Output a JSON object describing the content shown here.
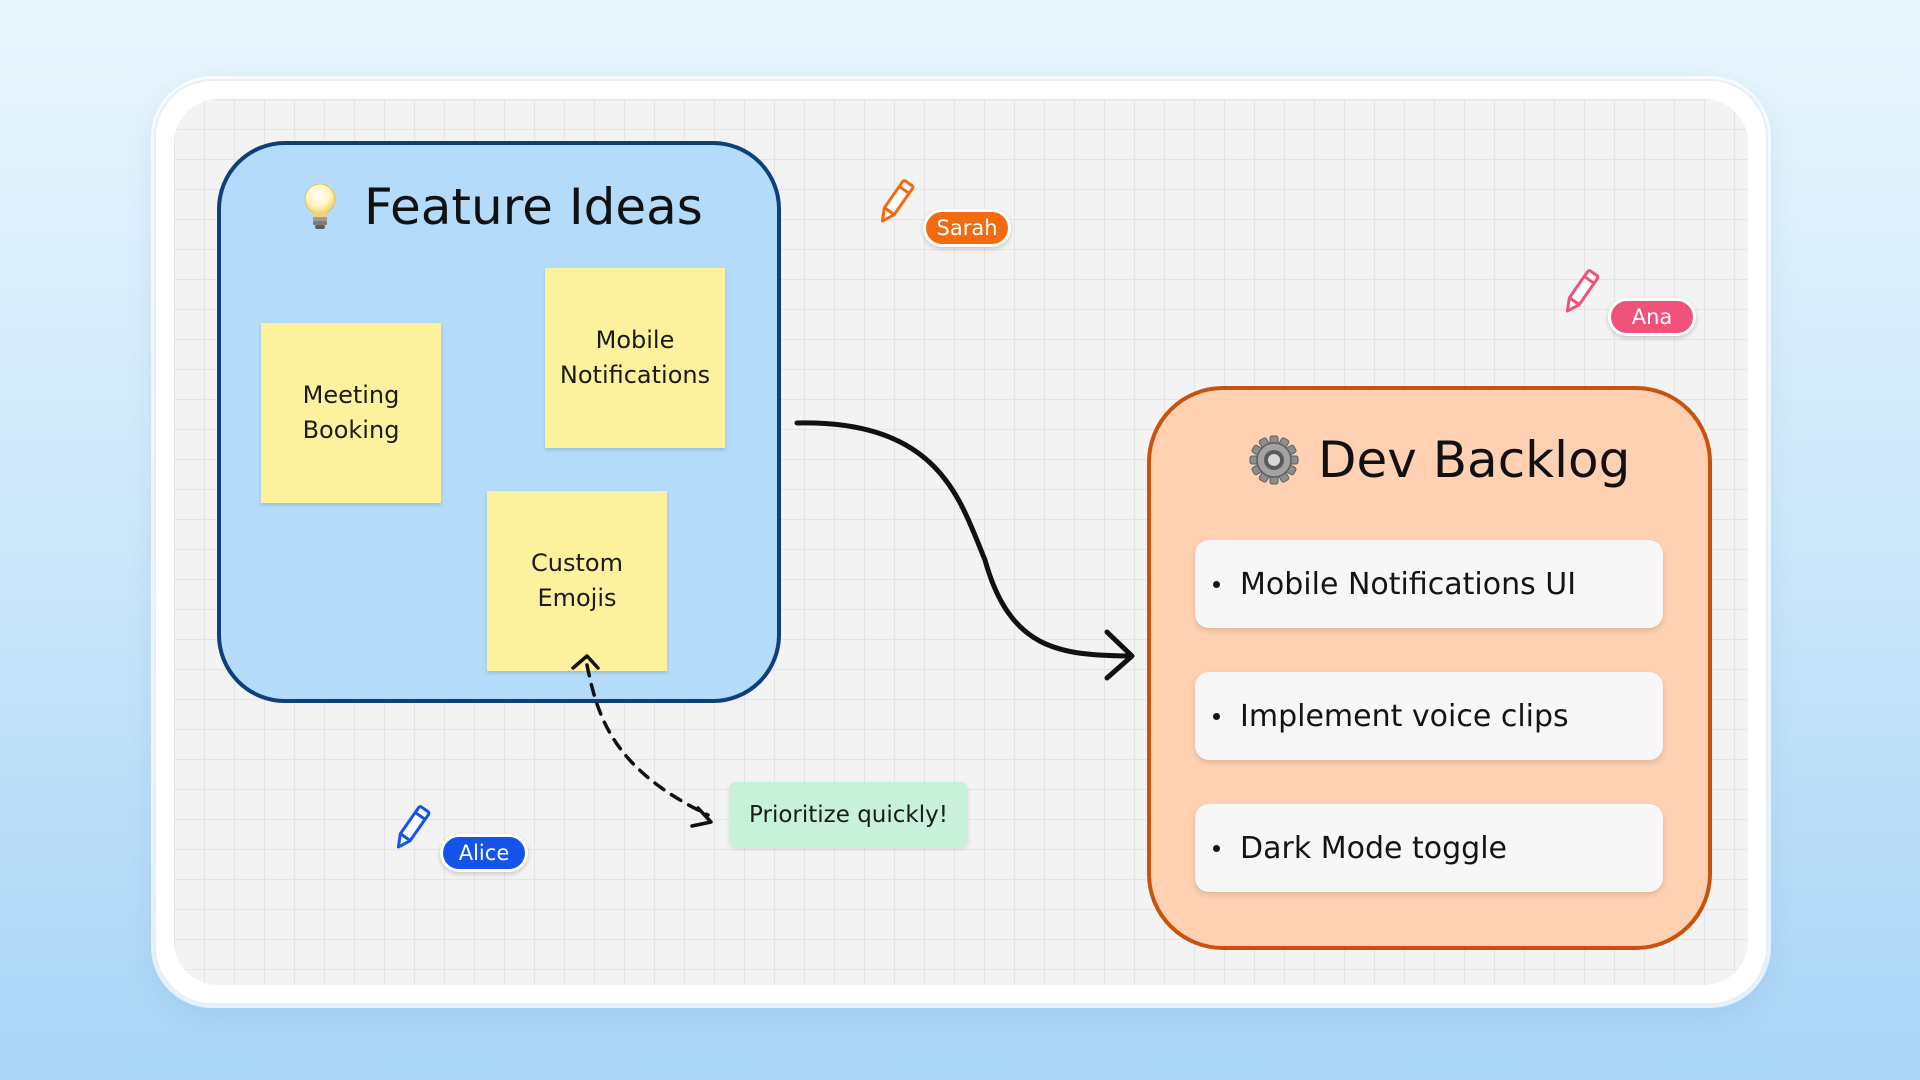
{
  "feature_ideas": {
    "title": "Feature Ideas",
    "icon": "lightbulb-icon",
    "color": "#b5dbfb",
    "border_color": "#0e3f7d",
    "stickies": [
      "Meeting Booking",
      "Mobile Notifications",
      "Custom Emojis"
    ]
  },
  "dev_backlog": {
    "title": "Dev Backlog",
    "icon": "gear-icon",
    "color": "#ffd0b2",
    "border_color": "#c9520f",
    "items": [
      "Mobile Notifications UI",
      "Implement voice clips",
      "Dark Mode toggle"
    ]
  },
  "comment": {
    "text": "Prioritize quickly!",
    "color": "#c7f1d8"
  },
  "cursors": [
    {
      "name": "Sarah",
      "color": "#f26b0f"
    },
    {
      "name": "Ana",
      "color": "#f0527a"
    },
    {
      "name": "Alice",
      "color": "#1554e8"
    }
  ],
  "colors": {
    "sticky": "#fcf29e",
    "connector": "#111111"
  }
}
